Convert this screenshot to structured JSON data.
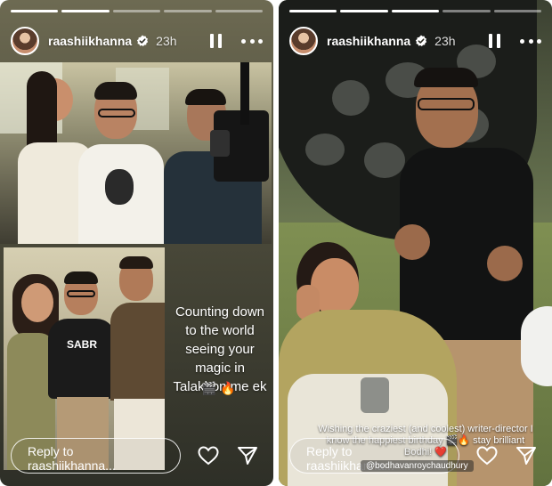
{
  "stories": [
    {
      "progress": [
        1,
        1,
        0,
        0,
        0
      ],
      "username": "raashiikhanna",
      "time": "23h",
      "caption": "Counting down to the world seeing your magic in Talakhon me ek",
      "caption_emoji": "🎬 🔥",
      "shirt_text": "SABR",
      "reply_placeholder": "Reply to raashiikhanna..."
    },
    {
      "progress": [
        1,
        1,
        1,
        0,
        0
      ],
      "username": "raashiikhanna",
      "time": "23h",
      "overlay_text": "Wishing the craziest (and coolest) writer-director I know the happiest birthday 🎬🔥 stay brilliant Bodhi! ❤️",
      "mention": "@bodhavanroychaudhury",
      "reply_placeholder": "Reply to raashiikhanna..."
    }
  ],
  "icons": {
    "verified": "verified-badge-icon",
    "pause": "pause-icon",
    "more": "more-options-icon",
    "like": "heart-icon",
    "share": "send-icon"
  },
  "colors": {
    "verified_blue": "#1d9bf0",
    "white": "#ffffff"
  }
}
